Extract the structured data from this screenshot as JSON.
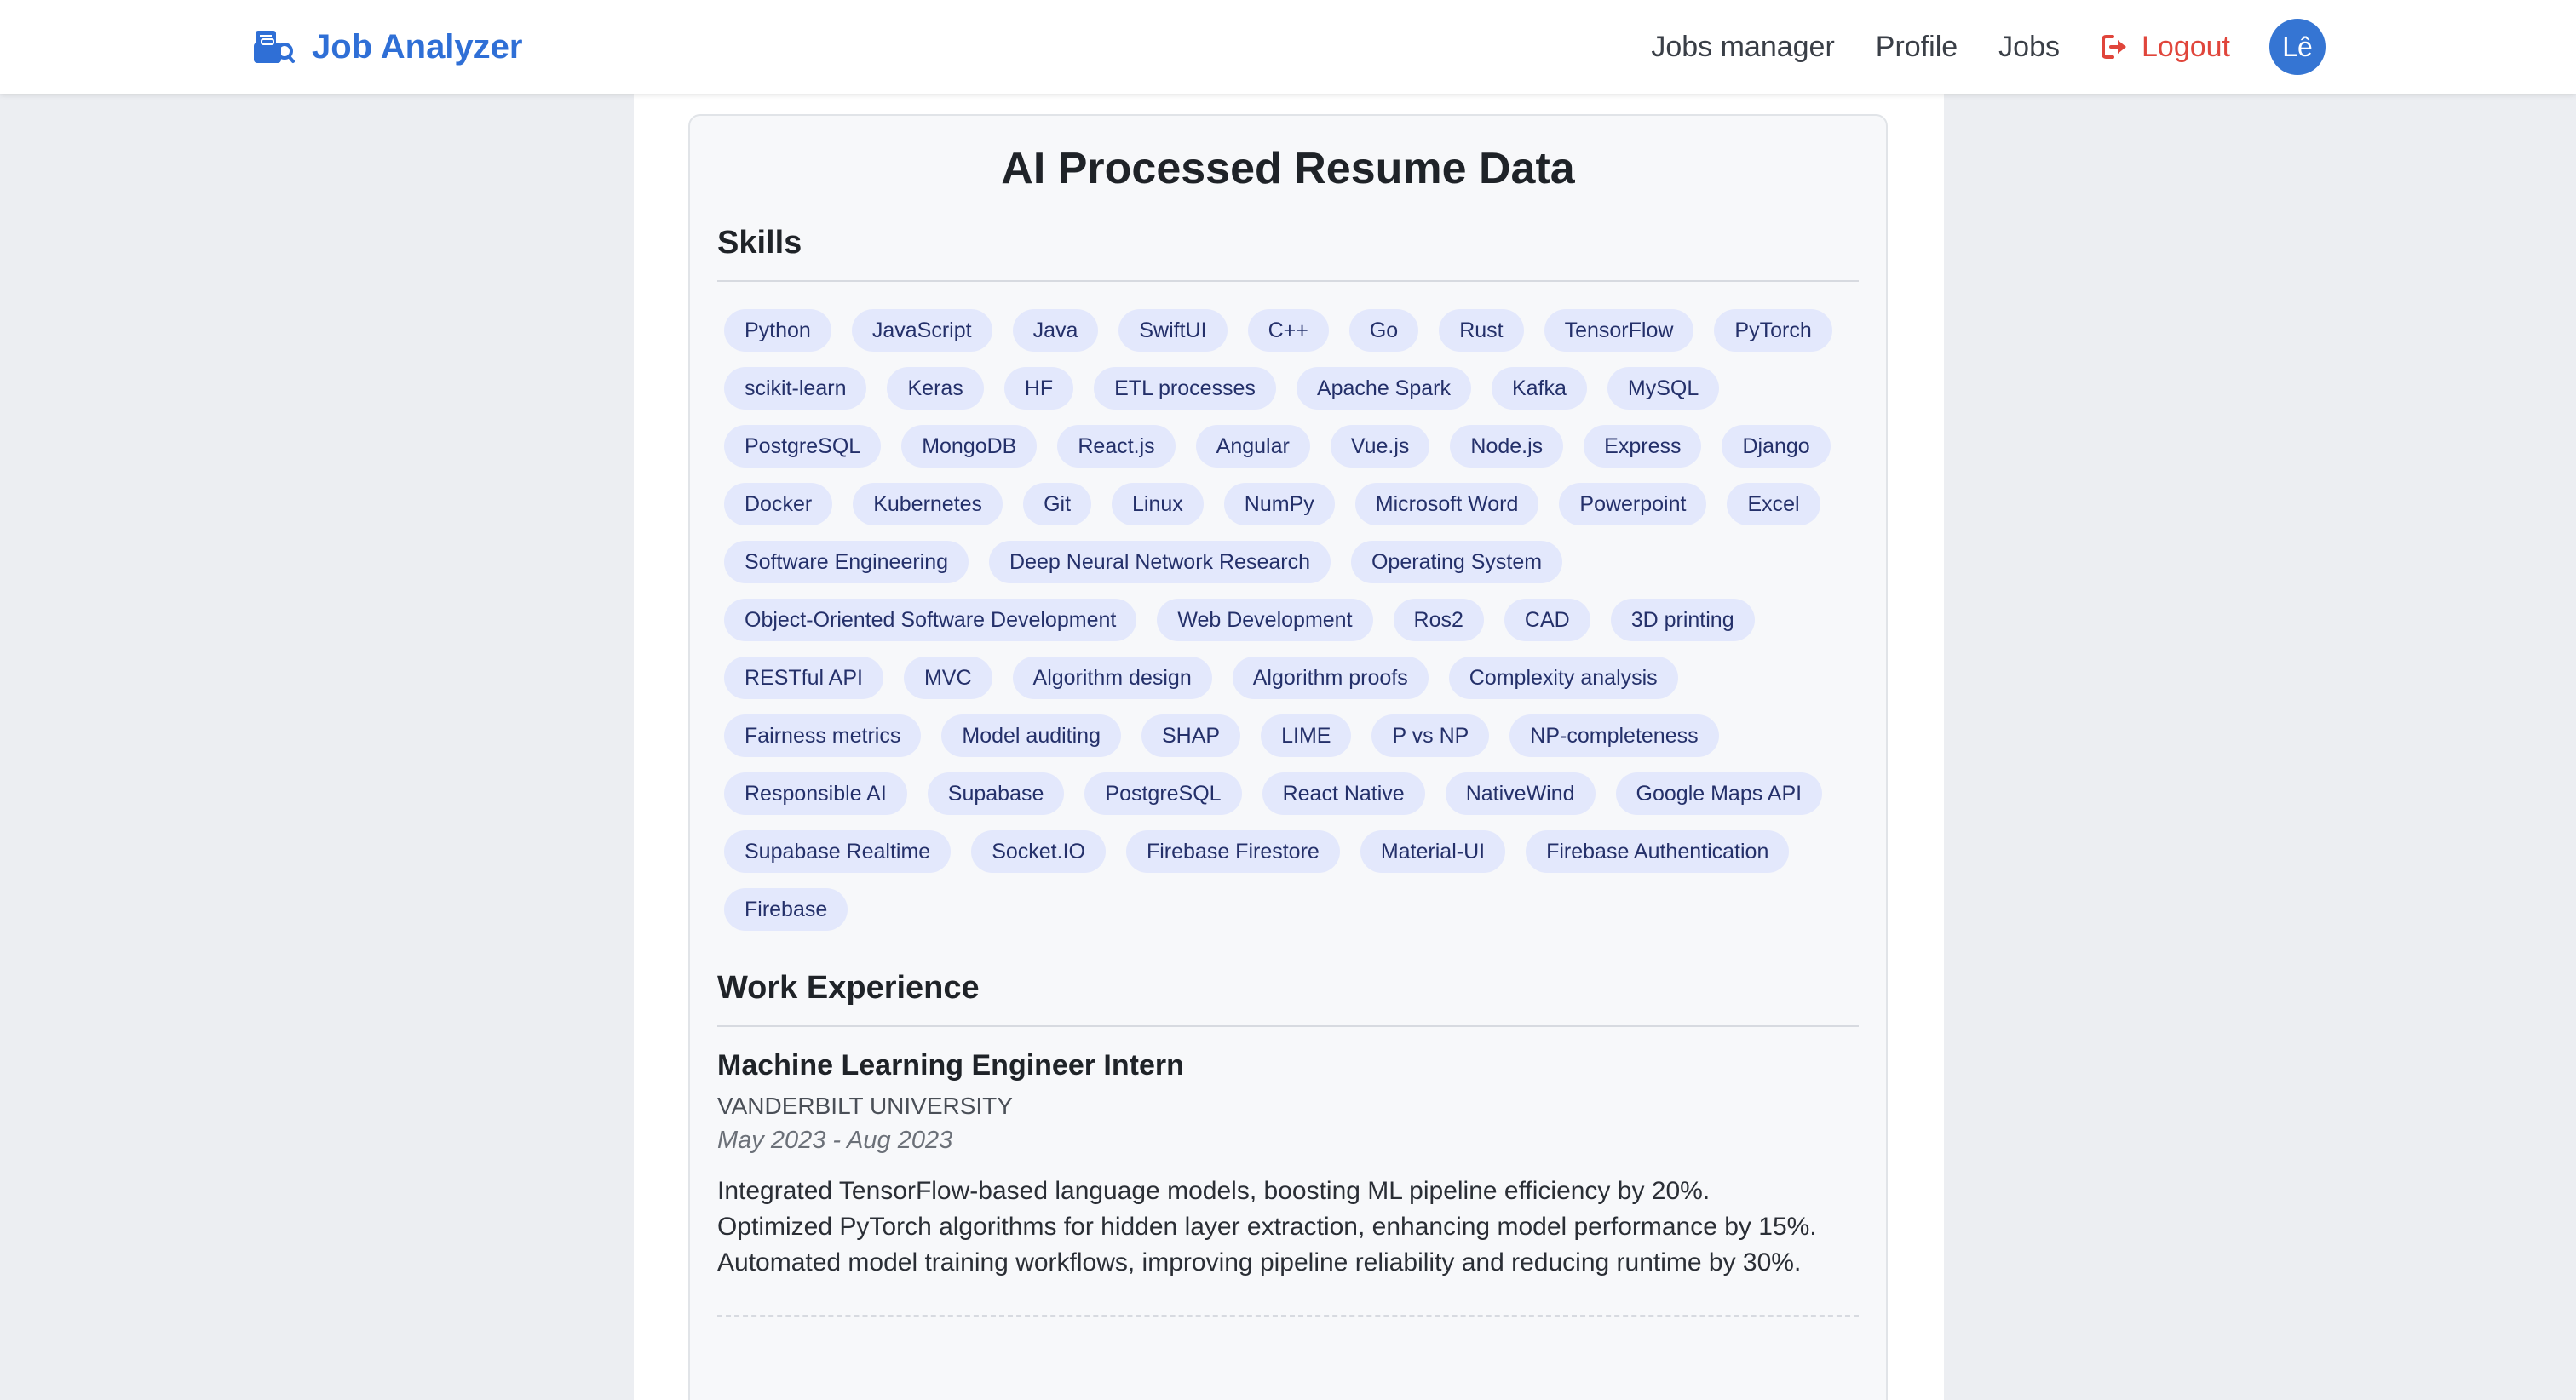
{
  "navbar": {
    "brand": "Job Analyzer",
    "links": [
      "Jobs manager",
      "Profile",
      "Jobs"
    ],
    "logout": "Logout",
    "avatar_initials": "Lê",
    "brand_color": "#2f6fd6",
    "logout_color": "#e0453b"
  },
  "card": {
    "title": "AI Processed Resume Data",
    "skills_heading": "Skills",
    "skills": [
      "Python",
      "JavaScript",
      "Java",
      "SwiftUI",
      "C++",
      "Go",
      "Rust",
      "TensorFlow",
      "PyTorch",
      "scikit-learn",
      "Keras",
      "HF",
      "ETL processes",
      "Apache Spark",
      "Kafka",
      "MySQL",
      "PostgreSQL",
      "MongoDB",
      "React.js",
      "Angular",
      "Vue.js",
      "Node.js",
      "Express",
      "Django",
      "Docker",
      "Kubernetes",
      "Git",
      "Linux",
      "NumPy",
      "Microsoft Word",
      "Powerpoint",
      "Excel",
      "Software Engineering",
      "Deep Neural Network Research",
      "Operating System",
      "Object-Oriented Software Development",
      "Web Development",
      "Ros2",
      "CAD",
      "3D printing",
      "RESTful API",
      "MVC",
      "Algorithm design",
      "Algorithm proofs",
      "Complexity analysis",
      "Fairness metrics",
      "Model auditing",
      "SHAP",
      "LIME",
      "P vs NP",
      "NP-completeness",
      "Responsible AI",
      "Supabase",
      "PostgreSQL",
      "React Native",
      "NativeWind",
      "Google Maps API",
      "Supabase Realtime",
      "Socket.IO",
      "Firebase Firestore",
      "Material-UI",
      "Firebase Authentication",
      "Firebase"
    ],
    "work_heading": "Work Experience",
    "jobs": [
      {
        "title": "Machine Learning Engineer Intern",
        "company": "VANDERBILT UNIVERSITY",
        "dates": "May 2023 - Aug 2023",
        "bullets": [
          "Integrated TensorFlow-based language models, boosting ML pipeline efficiency by 20%.",
          "Optimized PyTorch algorithms for hidden layer extraction, enhancing model performance by 15%.",
          "Automated model training workflows, improving pipeline reliability and reducing runtime by 30%."
        ]
      }
    ]
  }
}
